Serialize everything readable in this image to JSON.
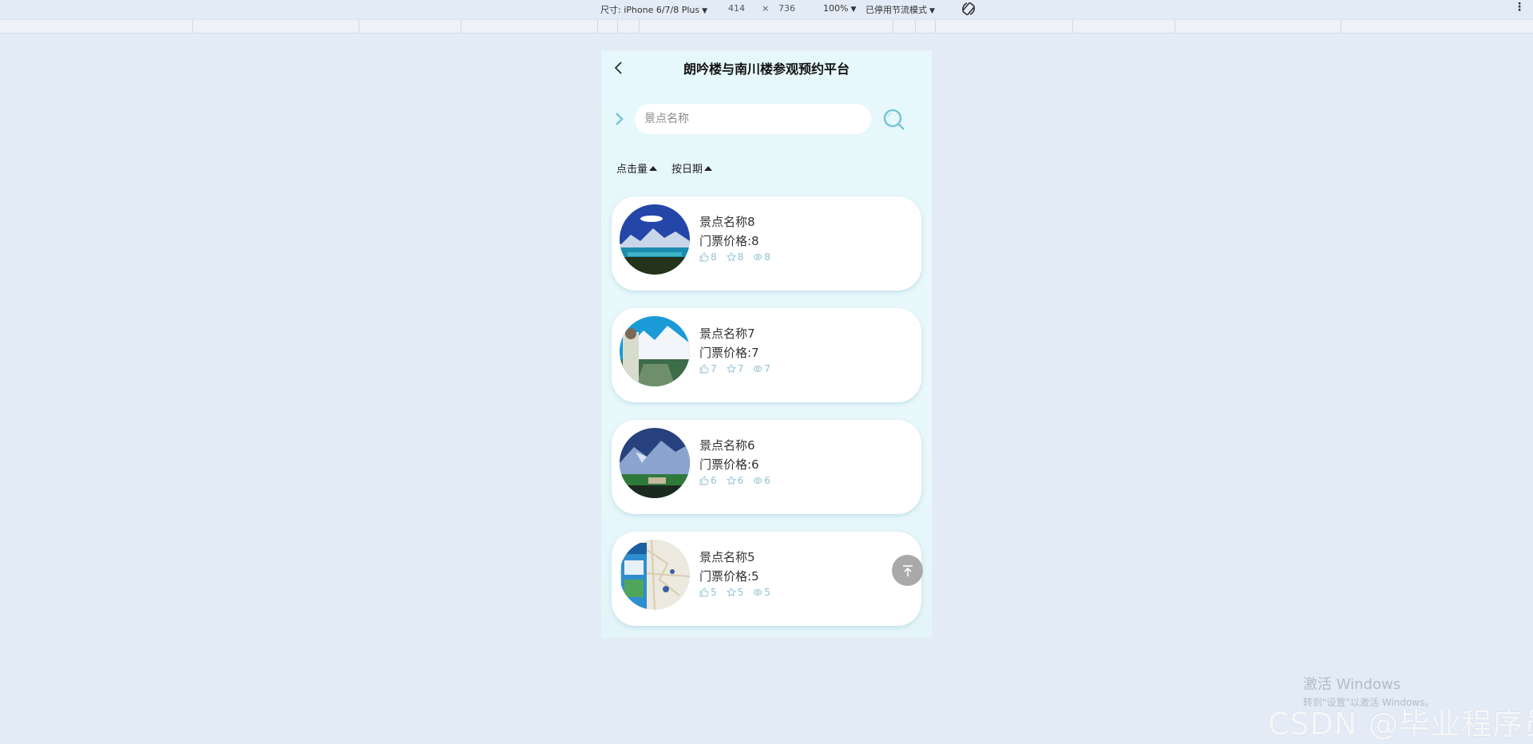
{
  "devtools": {
    "size_label": "尺寸: iPhone 6/7/8 Plus",
    "width": "414",
    "times": "×",
    "height": "736",
    "zoom": "100%",
    "throttle": "已停用节流模式",
    "rotate_icon": "rotate-icon",
    "more_icon": "more-icon"
  },
  "app": {
    "title": "朗吟楼与南川楼参观预约平台",
    "search_placeholder": "景点名称",
    "sort": [
      {
        "label": "点击量"
      },
      {
        "label": "按日期"
      }
    ],
    "items": [
      {
        "name": "景点名称8",
        "price": "门票价格:8",
        "likes": "8",
        "favorites": "8",
        "views": "8"
      },
      {
        "name": "景点名称7",
        "price": "门票价格:7",
        "likes": "7",
        "favorites": "7",
        "views": "7"
      },
      {
        "name": "景点名称6",
        "price": "门票价格:6",
        "likes": "6",
        "favorites": "6",
        "views": "6"
      },
      {
        "name": "景点名称5",
        "price": "门票价格:5",
        "likes": "5",
        "favorites": "5",
        "views": "5"
      }
    ],
    "accent_color": "#7cc5d8"
  },
  "watermarks": {
    "win_line1": "激活 Windows",
    "win_line2": "转到\"设置\"以激活 Windows。",
    "csdn": "CSDN @毕业程序员"
  }
}
